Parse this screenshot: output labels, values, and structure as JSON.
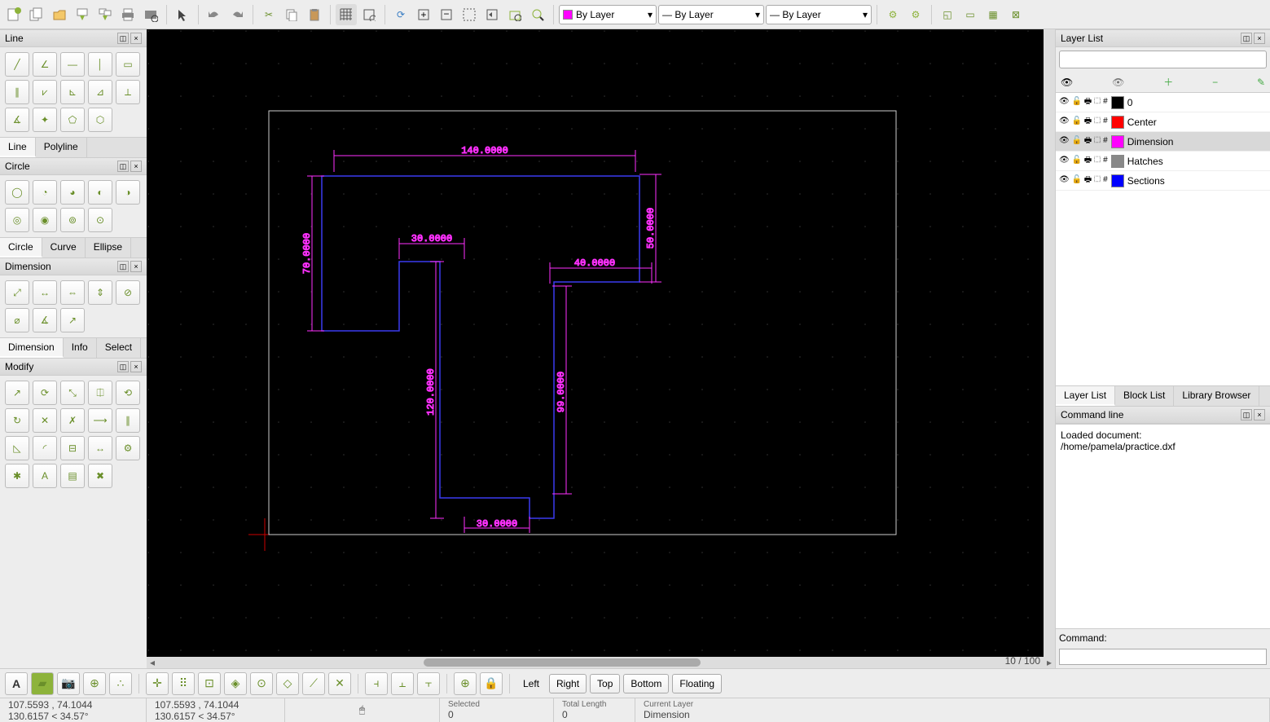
{
  "toolbar": {
    "color_combo": "By Layer",
    "width_combo": "— By Layer",
    "type_combo": "— By Layer"
  },
  "left_panels": {
    "line": {
      "title": "Line",
      "tabs": [
        "Line",
        "Polyline"
      ],
      "active_tab": 0
    },
    "circle": {
      "title": "Circle",
      "tabs": [
        "Circle",
        "Curve",
        "Ellipse"
      ],
      "active_tab": 0
    },
    "dimension": {
      "title": "Dimension",
      "tabs": [
        "Dimension",
        "Info",
        "Select"
      ],
      "active_tab": 0
    },
    "modify": {
      "title": "Modify"
    }
  },
  "layers": {
    "title": "Layer List",
    "tabs": [
      "Layer List",
      "Block List",
      "Library Browser"
    ],
    "active_tab": 0,
    "items": [
      {
        "name": "0",
        "color": "#000000",
        "selected": false
      },
      {
        "name": "Center",
        "color": "#ff0000",
        "selected": false
      },
      {
        "name": "Dimension",
        "color": "#ff00ff",
        "selected": true
      },
      {
        "name": "Hatches",
        "color": "#888888",
        "selected": false
      },
      {
        "name": "Sections",
        "color": "#0000ff",
        "selected": false
      }
    ]
  },
  "command_line": {
    "title": "Command line",
    "log_line1": "Loaded document:",
    "log_line2": "/home/pamela/practice.dxf",
    "prompt": "Command:"
  },
  "canvas": {
    "zoom": "10 / 100",
    "dims": {
      "d1": "140.0000",
      "d2": "30.0000",
      "d3": "40.0000",
      "d4": "50.0000",
      "d5": "70.0000",
      "d6": "120.0000",
      "d7": "99.0000",
      "d8": "30.0000"
    }
  },
  "dock_buttons": [
    "Left",
    "Right",
    "Top",
    "Bottom",
    "Floating"
  ],
  "status": {
    "abs1": "107.5593 , 74.1044",
    "rel1": "130.6157 < 34.57°",
    "abs2": "107.5593 , 74.1044",
    "rel2": "130.6157 < 34.57°",
    "selected_label": "Selected",
    "selected_val": "0",
    "length_label": "Total Length",
    "length_val": "0",
    "layer_label": "Current Layer",
    "layer_val": "Dimension"
  }
}
